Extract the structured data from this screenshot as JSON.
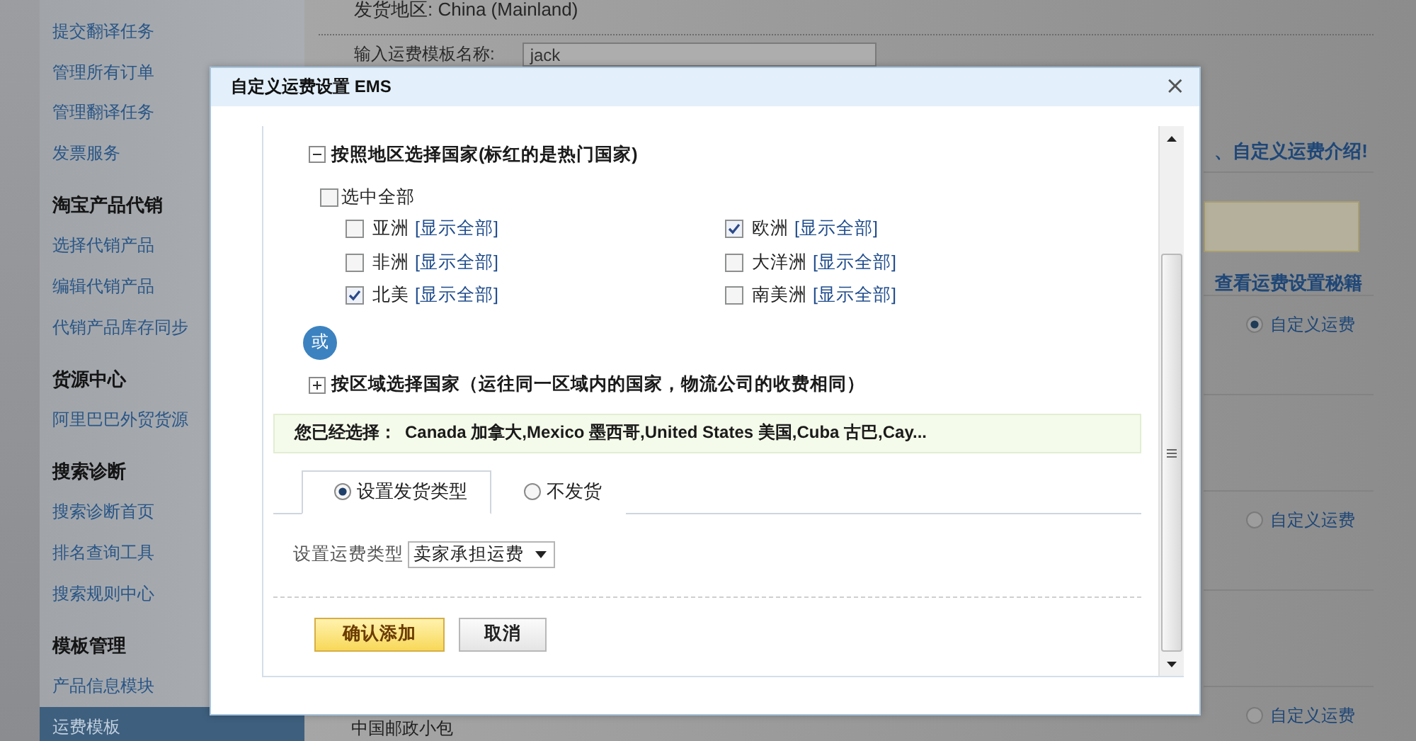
{
  "sidebar": {
    "items": [
      {
        "kind": "link",
        "label": "提交翻译任务",
        "selected": false
      },
      {
        "kind": "link",
        "label": "管理所有订单",
        "selected": false
      },
      {
        "kind": "link",
        "label": "管理翻译任务",
        "selected": false
      },
      {
        "kind": "link",
        "label": "发票服务",
        "selected": false
      },
      {
        "kind": "heading",
        "label": "淘宝产品代销"
      },
      {
        "kind": "link",
        "label": "选择代销产品",
        "selected": false
      },
      {
        "kind": "link",
        "label": "编辑代销产品",
        "selected": false
      },
      {
        "kind": "link",
        "label": "代销产品库存同步",
        "selected": false
      },
      {
        "kind": "heading",
        "label": "货源中心"
      },
      {
        "kind": "link",
        "label": "阿里巴巴外贸货源",
        "selected": false
      },
      {
        "kind": "heading",
        "label": "搜索诊断"
      },
      {
        "kind": "link",
        "label": "搜索诊断首页",
        "selected": false
      },
      {
        "kind": "link",
        "label": "排名查询工具",
        "selected": false
      },
      {
        "kind": "link",
        "label": "搜索规则中心",
        "selected": false
      },
      {
        "kind": "heading",
        "label": "模板管理"
      },
      {
        "kind": "link",
        "label": "产品信息模块",
        "selected": false
      },
      {
        "kind": "link",
        "label": "运费模板",
        "selected": true
      }
    ]
  },
  "page": {
    "origin": "发货地区: China (Mainland)",
    "name_label": "输入运费模板名称:",
    "name_value": "jack",
    "intro_link": "、自定义运费介绍!",
    "tips_link": "查看运费设置秘籍",
    "options": [
      {
        "label": "自定义运费",
        "selected": true
      },
      {
        "label": "自定义运费",
        "selected": false
      },
      {
        "label": "自定义运费",
        "selected": false
      }
    ],
    "service_name": "中国邮政小包"
  },
  "dialog": {
    "title": "自定义运费设置 EMS",
    "close": "×",
    "region_section": {
      "title": "按照地区选择国家(标红的是热门国家)",
      "expanded": true,
      "select_all": {
        "label": "选中全部",
        "checked": false
      },
      "regions": [
        {
          "name": "亚洲",
          "link": "[显示全部]",
          "checked": false
        },
        {
          "name": "欧洲",
          "link": "[显示全部]",
          "checked": true
        },
        {
          "name": "非洲",
          "link": "[显示全部]",
          "checked": false
        },
        {
          "name": "大洋洲",
          "link": "[显示全部]",
          "checked": false
        },
        {
          "name": "北美",
          "link": "[显示全部]",
          "checked": true
        },
        {
          "name": "南美洲",
          "link": "[显示全部]",
          "checked": false
        }
      ]
    },
    "or_badge": "或",
    "area_section": {
      "title": "按区域选择国家（运往同一区域内的国家，物流公司的收费相同）",
      "expanded": false
    },
    "selection": {
      "label": "您已经选择：",
      "value": "Canada 加拿大,Mexico 墨西哥,United States 美国,Cuba 古巴,Cay..."
    },
    "tabs": [
      {
        "label": "设置发货类型",
        "selected": true
      },
      {
        "label": "不发货",
        "selected": false
      }
    ],
    "fee_type": {
      "label": "设置运费类型",
      "value": "卖家承担运费"
    },
    "buttons": [
      {
        "label": "确认添加",
        "kind": "primary"
      },
      {
        "label": "取消",
        "kind": "secondary"
      }
    ]
  }
}
